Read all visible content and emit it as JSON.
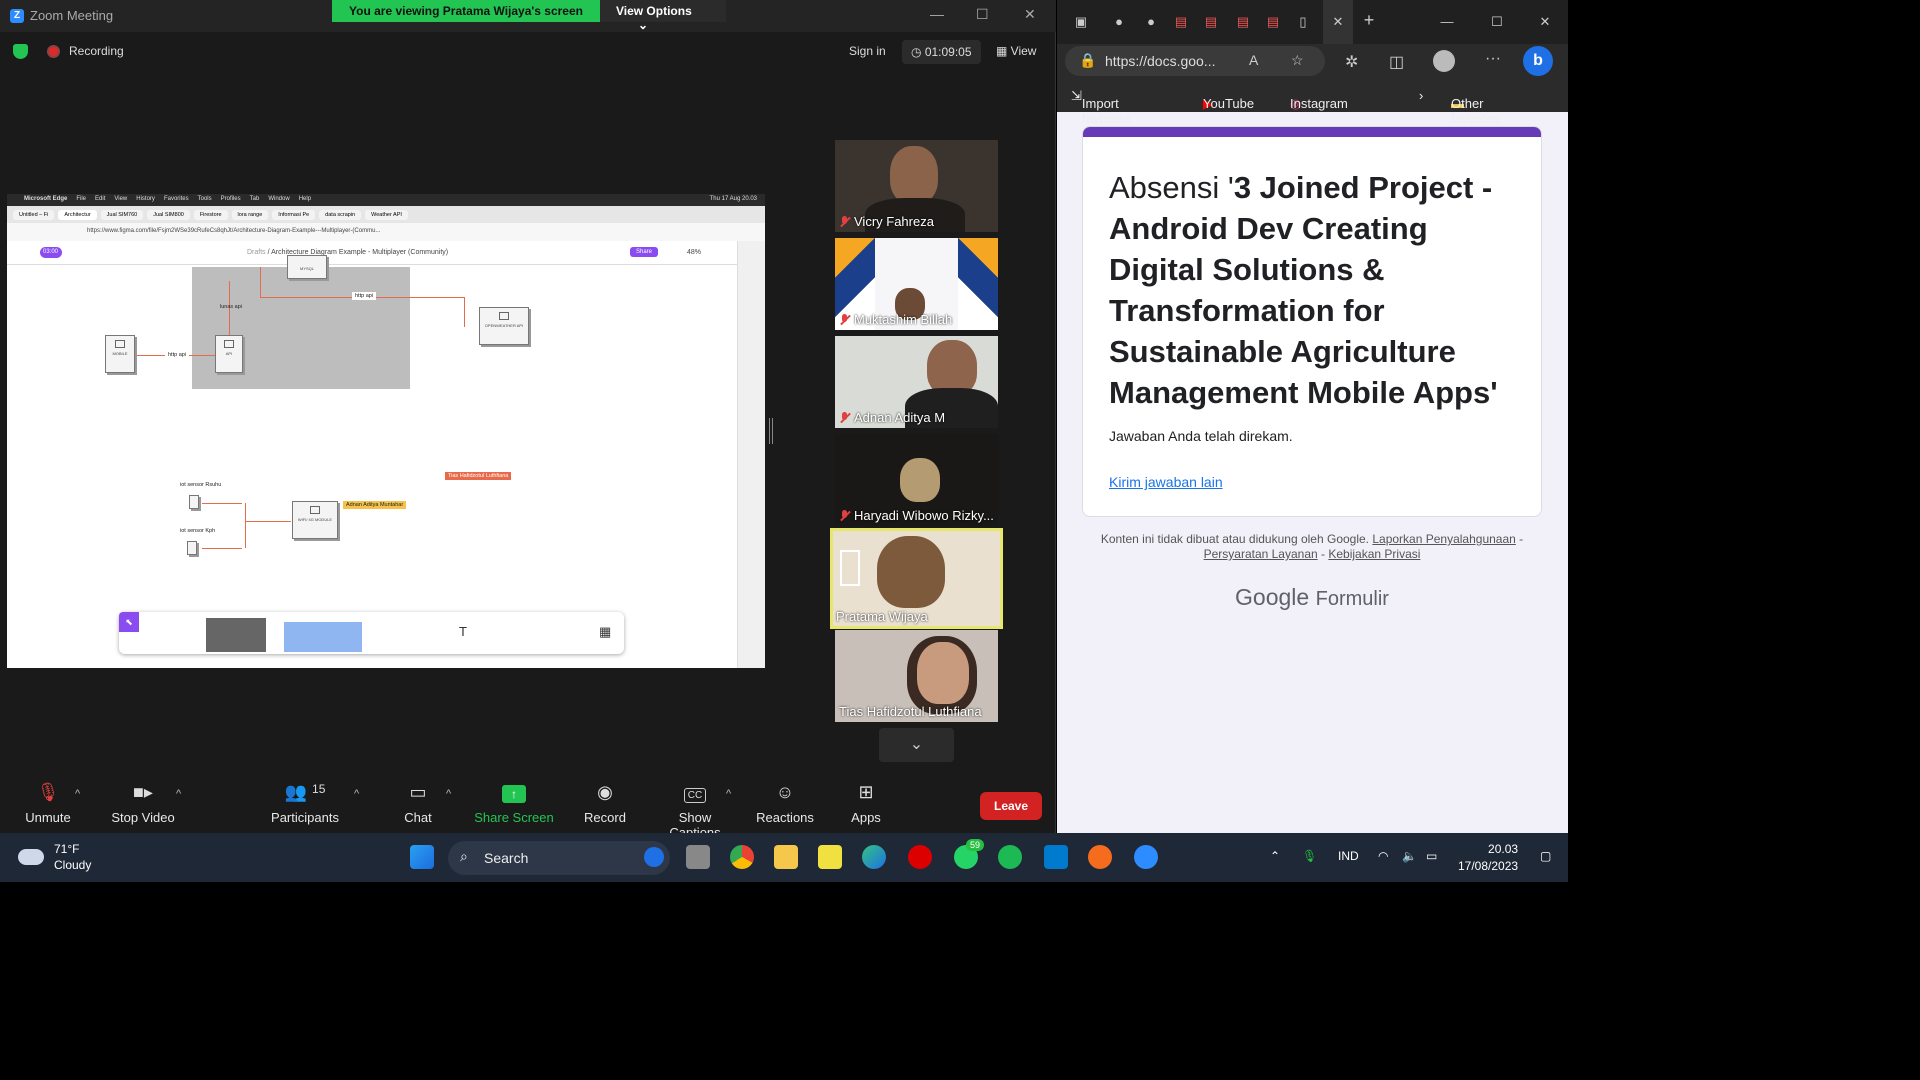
{
  "zoom": {
    "window_title": "Zoom Meeting",
    "viewing_banner": "You are viewing Pratama Wijaya's screen",
    "view_options": "View Options",
    "recording": "Recording",
    "sign_in": "Sign in",
    "timer": "01:09:05",
    "view": "View",
    "participants": [
      {
        "name": "Vicry Fahreza"
      },
      {
        "name": "Muktashim Billah"
      },
      {
        "name": "Adnan Aditya M"
      },
      {
        "name": "Haryadi Wibowo Rizky..."
      },
      {
        "name": "Pratama Wijaya"
      },
      {
        "name": "Tias Hafidzotul Luthfiana"
      }
    ],
    "toolbar": {
      "unmute": "Unmute",
      "stop_video": "Stop Video",
      "participants": "Participants",
      "participant_count": "15",
      "chat": "Chat",
      "share_screen": "Share Screen",
      "record": "Record",
      "show_captions": "Show Captions",
      "reactions": "Reactions",
      "apps": "Apps",
      "leave": "Leave"
    }
  },
  "shared_screen": {
    "mac_menu": [
      "Microsoft Edge",
      "File",
      "Edit",
      "View",
      "History",
      "Favorites",
      "Tools",
      "Profiles",
      "Tab",
      "Window",
      "Help"
    ],
    "mac_clock": "Thu 17 Aug 20.03",
    "tabs": [
      "Untitled – Fi",
      "Architectur",
      "Jual SIM760",
      "Jual SIM800",
      "Firestore",
      "lora range",
      "Informasi Pe",
      "data scrapin",
      "Weather API"
    ],
    "url": "https://www.figma.com/file/Fsjm2WSe39cRufeCs8qhJt/Architecture-Diagram-Example---Multiplayer-(Commu...",
    "timer": "03:00",
    "breadcrumb_drafts": "Drafts",
    "file_title": "Architecture Diagram Example - Multiplayer (Community)",
    "share": "Share",
    "zoom_pct": "48%",
    "nodes": {
      "mobile": "MOBILE",
      "api": "API",
      "openweather": "OPENWEATHER API",
      "mysql": "MYSQL",
      "wifi": "WIFI/ 4G MODULE",
      "sensor_ruhu": "iot sensor Rsuhu",
      "sensor_kph": "iot sensor Kph"
    },
    "edges": {
      "http_api": "http api",
      "lunas_api": "lunas api",
      "http_api_2": "http api"
    },
    "cursor_tias": "Tias Hafidzotul Luthfiana",
    "cursor_adnan": "Adnan Aditya Muntahar"
  },
  "edge": {
    "url": "https://docs.goo...",
    "favorites": [
      "Import favorites",
      "YouTube",
      "Instagram",
      "Other favorites"
    ],
    "form_title_light": "Absensi '",
    "form_title_bold": "3 Joined Project - Android Dev Creating Digital Solutions & Transformation for Sustainable Agriculture Management Mobile Apps'",
    "response_recorded": "Jawaban Anda telah direkam.",
    "submit_another": "Kirim jawaban lain",
    "footer_text": "Konten ini tidak dibuat atau didukung oleh Google.",
    "footer_report": "Laporkan Penyalahgunaan",
    "footer_terms": "Persyaratan Layanan",
    "footer_privacy": "Kebijakan Privasi",
    "footer_sep": "-",
    "brand_google": "Google",
    "brand_forms": "Formulir"
  },
  "taskbar": {
    "temp": "71°F",
    "weather": "Cloudy",
    "search": "Search",
    "whatsapp_badge": "59",
    "lang": "IND",
    "time": "20.03",
    "date": "17/08/2023"
  }
}
